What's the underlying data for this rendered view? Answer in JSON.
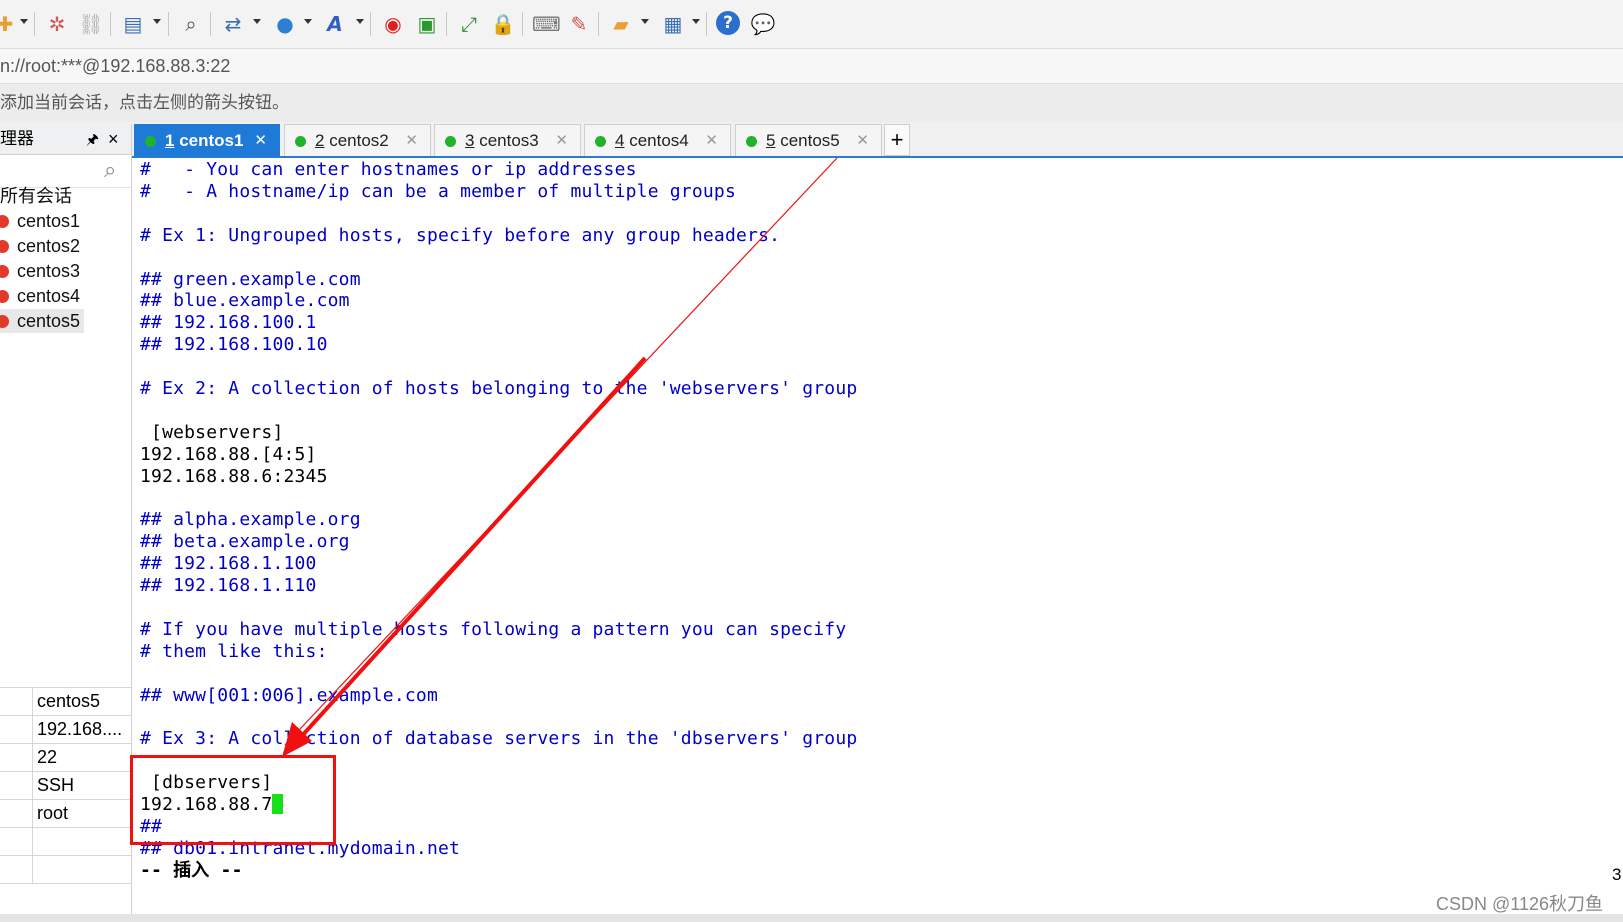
{
  "toolbar": {
    "icons": [
      "new-session-icon",
      "disconnect-icon",
      "reconnect-icon",
      "session-manager-icon",
      "find-icon",
      "transfer-icon",
      "globe-icon",
      "font-icon",
      "xshell-icon",
      "xftp-icon",
      "fullscreen-icon",
      "lock-icon",
      "keyboard-icon",
      "highlight-icon",
      "new-tab-group-icon",
      "layout-icon",
      "help-icon",
      "chat-icon"
    ]
  },
  "address": "n://root:***@192.168.88.3:22",
  "hint": "添加当前会话，点击左侧的箭头按钮。",
  "sidebar": {
    "title": "理器",
    "pin": "📌",
    "close": "×",
    "tree_root": "所有会话",
    "sessions": [
      "centos1",
      "centos2",
      "centos3",
      "centos4",
      "centos5"
    ],
    "properties": [
      "centos5",
      "192.168....",
      "22",
      "SSH",
      "root",
      ""
    ]
  },
  "tabs": [
    {
      "num": "1",
      "name": "centos1",
      "active": true
    },
    {
      "num": "2",
      "name": "centos2",
      "active": false
    },
    {
      "num": "3",
      "name": "centos3",
      "active": false
    },
    {
      "num": "4",
      "name": "centos4",
      "active": false
    },
    {
      "num": "5",
      "name": "centos5",
      "active": false
    }
  ],
  "tab_add": "+",
  "terminal": {
    "lines": [
      {
        "t": "#   - You can enter hostnames or ip addresses",
        "c": "comment"
      },
      {
        "t": "#   - A hostname/ip can be a member of multiple groups",
        "c": "comment"
      },
      {
        "t": "",
        "c": "plain"
      },
      {
        "t": "# Ex 1: Ungrouped hosts, specify before any group headers.",
        "c": "comment"
      },
      {
        "t": "",
        "c": "plain"
      },
      {
        "t": "## green.example.com",
        "c": "comment"
      },
      {
        "t": "## blue.example.com",
        "c": "comment"
      },
      {
        "t": "## 192.168.100.1",
        "c": "comment"
      },
      {
        "t": "## 192.168.100.10",
        "c": "comment"
      },
      {
        "t": "",
        "c": "plain"
      },
      {
        "t": "# Ex 2: A collection of hosts belonging to the 'webservers' group",
        "c": "comment"
      },
      {
        "t": "",
        "c": "plain"
      },
      {
        "t": " [webservers]",
        "c": "plain"
      },
      {
        "t": "192.168.88.[4:5]",
        "c": "plain"
      },
      {
        "t": "192.168.88.6:2345",
        "c": "plain"
      },
      {
        "t": "",
        "c": "plain"
      },
      {
        "t": "## alpha.example.org",
        "c": "comment"
      },
      {
        "t": "## beta.example.org",
        "c": "comment"
      },
      {
        "t": "## 192.168.1.100",
        "c": "comment"
      },
      {
        "t": "## 192.168.1.110",
        "c": "comment"
      },
      {
        "t": "",
        "c": "plain"
      },
      {
        "t": "# If you have multiple hosts following a pattern you can specify",
        "c": "comment"
      },
      {
        "t": "# them like this:",
        "c": "comment"
      },
      {
        "t": "",
        "c": "plain"
      },
      {
        "t": "## www[001:006].example.com",
        "c": "comment"
      },
      {
        "t": "",
        "c": "plain"
      },
      {
        "t": "# Ex 3: A collection of database servers in the 'dbservers' group",
        "c": "comment"
      },
      {
        "t": "",
        "c": "plain"
      },
      {
        "t": " [dbservers]",
        "c": "plain"
      },
      {
        "t": "192.168.88.7",
        "c": "plain",
        "cursor": true
      },
      {
        "t": "##",
        "c": "comment"
      },
      {
        "t": "## db01.intranet.mydomain.net",
        "c": "comment"
      },
      {
        "t": "-- 插入 --",
        "c": "bold"
      }
    ]
  },
  "edge_number": "3",
  "watermark": "CSDN @1126秋刀鱼",
  "colors": {
    "accent": "#1e7ad6",
    "comment": "#0000c8",
    "annotation": "#f01010",
    "cursor": "#18e018",
    "session_dot": "#1fb22a"
  }
}
